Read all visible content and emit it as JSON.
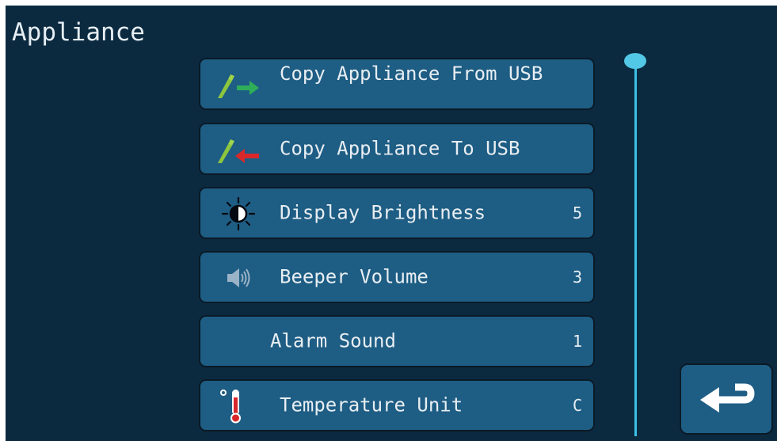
{
  "screen": {
    "title": "Appliance"
  },
  "menu": {
    "items": [
      {
        "label": "Copy Appliance From USB",
        "value": "",
        "icon": "usb-import-icon"
      },
      {
        "label": "Copy Appliance To USB",
        "value": "",
        "icon": "usb-export-icon"
      },
      {
        "label": "Display Brightness",
        "value": "5",
        "icon": "brightness-icon"
      },
      {
        "label": "Beeper Volume",
        "value": "3",
        "icon": "speaker-icon"
      },
      {
        "label": "Alarm Sound",
        "value": "1",
        "icon": ""
      },
      {
        "label": "Temperature Unit",
        "value": "C",
        "icon": "thermometer-icon"
      }
    ]
  },
  "navigation": {
    "back_icon": "return-arrow-icon"
  },
  "colors": {
    "background": "#0b2a40",
    "button": "#1e5d84",
    "scroll_accent": "#3ec0e6",
    "arrow_in": "#2fae5a",
    "arrow_out": "#d8282a",
    "usb_stick": "#8cc63e"
  }
}
